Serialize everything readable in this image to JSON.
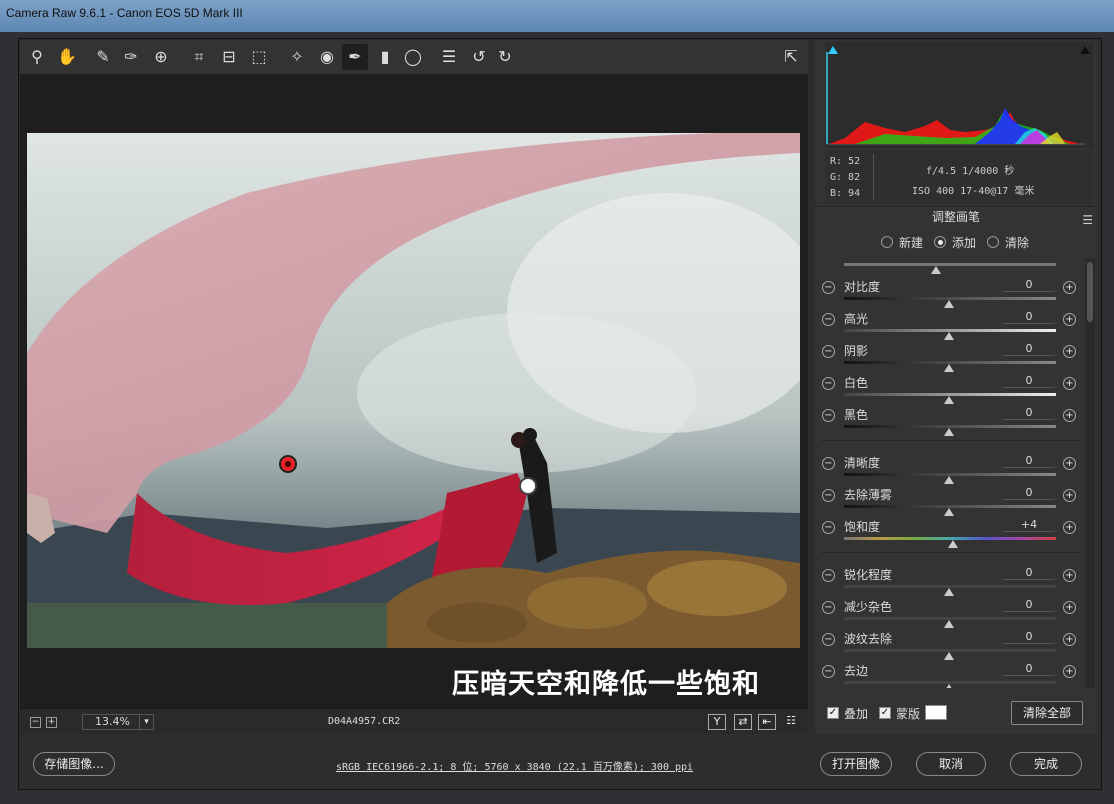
{
  "window": {
    "title": "Camera Raw 9.6.1 -  Canon EOS 5D Mark III"
  },
  "toolbar": {
    "tools": [
      "zoom-icon",
      "hand-icon",
      "white-balance-icon",
      "color-sampler-icon",
      "target-adjust-icon",
      "crop-icon",
      "straighten-icon",
      "transform-icon",
      "spot-removal-icon",
      "red-eye-icon",
      "adjustment-brush-icon",
      "graduated-filter-icon",
      "radial-filter-icon",
      "preferences-icon",
      "rotate-left-icon",
      "rotate-right-icon"
    ],
    "fullscreen_icon": "fullscreen-icon"
  },
  "image": {
    "caption": "压暗天空和降低一些饱和"
  },
  "status": {
    "zoom": "13.4%",
    "filename": "D04A4957.CR2"
  },
  "readout": {
    "r": "R:  52",
    "g": "G:  82",
    "b": "B:  94",
    "exif1": "f/4.5  1/4000 秒",
    "exif2": "ISO 400  17-40@17 毫米"
  },
  "panel": {
    "title": "调整画笔",
    "modes": [
      "新建",
      "添加",
      "清除"
    ],
    "selected_mode": "添加"
  },
  "sliders": [
    {
      "label": "对比度",
      "value": "0"
    },
    {
      "label": "高光",
      "value": "0"
    },
    {
      "label": "阴影",
      "value": "0"
    },
    {
      "label": "白色",
      "value": "0"
    },
    {
      "label": "黑色",
      "value": "0"
    },
    {
      "label": "清晰度",
      "value": "0"
    },
    {
      "label": "去除薄雾",
      "value": "0"
    },
    {
      "label": "饱和度",
      "value": "+4"
    },
    {
      "label": "锐化程度",
      "value": "0"
    },
    {
      "label": "减少杂色",
      "value": "0"
    },
    {
      "label": "波纹去除",
      "value": "0"
    },
    {
      "label": "去边",
      "value": "0"
    }
  ],
  "bottom": {
    "overlay": "叠加",
    "mask": "蒙版",
    "clear_all": "清除全部"
  },
  "footer": {
    "save": "存储图像...",
    "workflow": "sRGB IEC61966-2.1; 8 位; 5760 x 3840 (22.1 百万像素); 300 ppi",
    "open": "打开图像",
    "cancel": "取消",
    "done": "完成"
  }
}
